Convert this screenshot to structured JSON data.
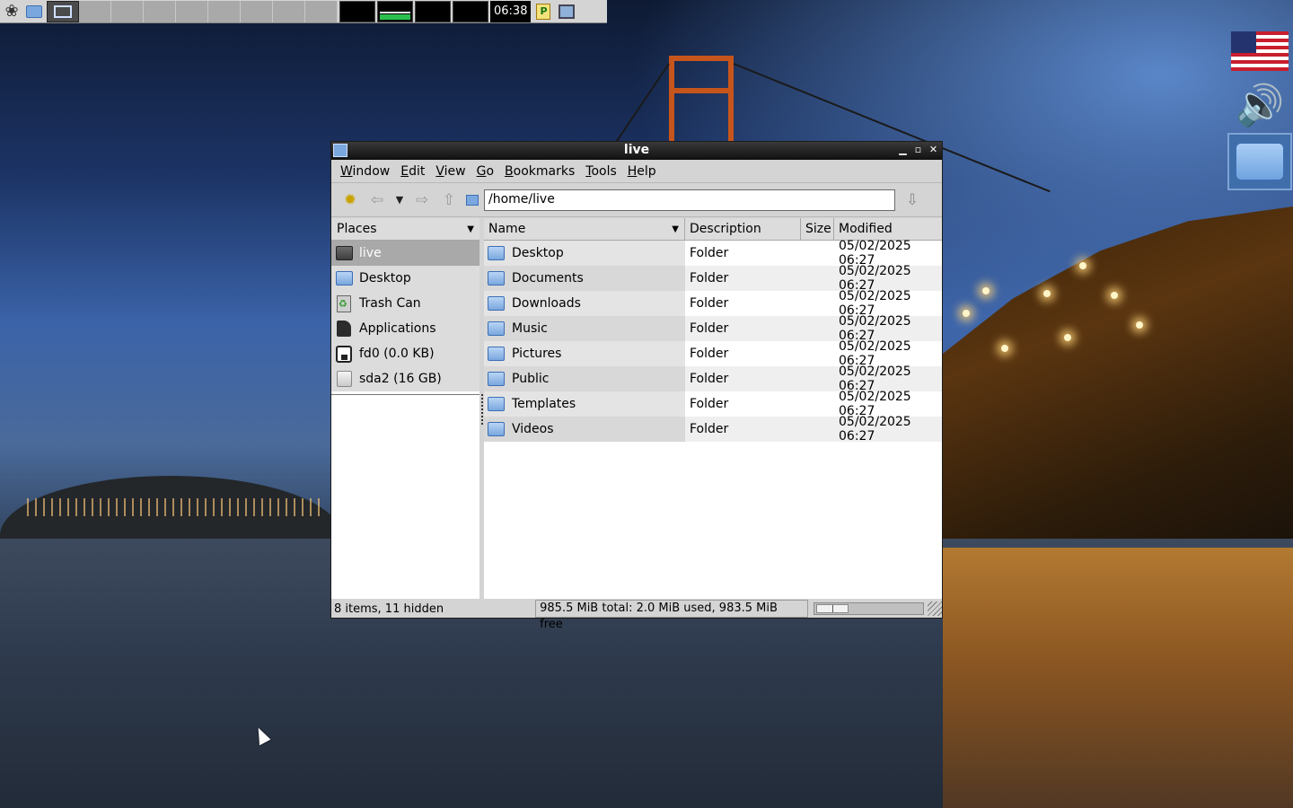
{
  "panel": {
    "clock": "06:38",
    "monitors": 4
  },
  "window": {
    "title": "live",
    "menu": [
      "Window",
      "Edit",
      "View",
      "Go",
      "Bookmarks",
      "Tools",
      "Help"
    ],
    "location": "/home/live",
    "places": {
      "header": "Places",
      "items": [
        {
          "label": "live",
          "icon": "home-folder-icon",
          "selected": true
        },
        {
          "label": "Desktop",
          "icon": "desktop-folder-icon",
          "selected": false
        },
        {
          "label": "Trash Can",
          "icon": "trash-icon",
          "selected": false
        },
        {
          "label": "Applications",
          "icon": "applications-icon",
          "selected": false
        },
        {
          "label": "fd0 (0.0 KB)",
          "icon": "floppy-icon",
          "selected": false
        },
        {
          "label": "sda2 (16 GB)",
          "icon": "disk-icon",
          "selected": false
        }
      ]
    },
    "columns": {
      "name": "Name",
      "description": "Description",
      "size": "Size",
      "modified": "Modified"
    },
    "files": [
      {
        "name": "Desktop",
        "description": "Folder",
        "size": "",
        "modified": "05/02/2025 06:27"
      },
      {
        "name": "Documents",
        "description": "Folder",
        "size": "",
        "modified": "05/02/2025 06:27"
      },
      {
        "name": "Downloads",
        "description": "Folder",
        "size": "",
        "modified": "05/02/2025 06:27"
      },
      {
        "name": "Music",
        "description": "Folder",
        "size": "",
        "modified": "05/02/2025 06:27"
      },
      {
        "name": "Pictures",
        "description": "Folder",
        "size": "",
        "modified": "05/02/2025 06:27"
      },
      {
        "name": "Public",
        "description": "Folder",
        "size": "",
        "modified": "05/02/2025 06:27"
      },
      {
        "name": "Templates",
        "description": "Folder",
        "size": "",
        "modified": "05/02/2025 06:27"
      },
      {
        "name": "Videos",
        "description": "Folder",
        "size": "",
        "modified": "05/02/2025 06:27"
      }
    ],
    "status": {
      "items": "8 items, 11 hidden",
      "disk": "985.5 MiB total: 2.0 MiB used, 983.5 MiB free"
    }
  },
  "colors": {
    "titlebar": "#101010",
    "selection": "#a9a9a9",
    "folder": "#7aa7de"
  }
}
